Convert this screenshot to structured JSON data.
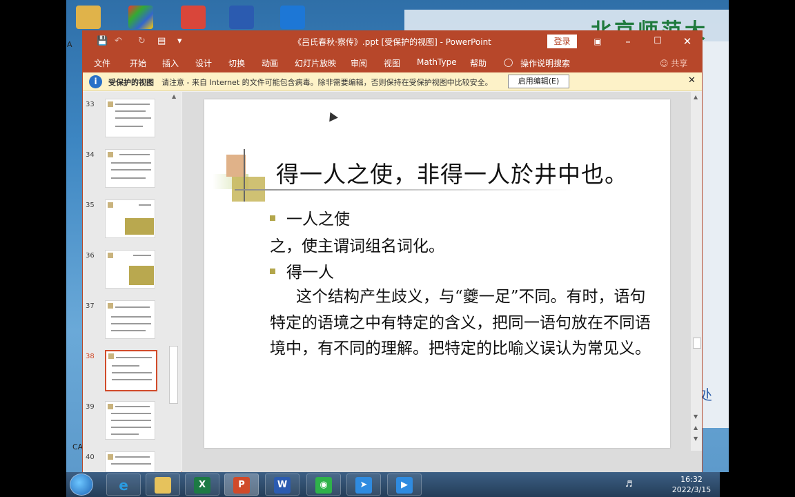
{
  "window": {
    "title": "《吕氏春秋·察传》.ppt [受保护的视图] - PowerPoint",
    "login_label": "登录"
  },
  "menu": {
    "items": [
      "文件",
      "开始",
      "插入",
      "设计",
      "切换",
      "动画",
      "幻灯片放映",
      "审阅",
      "视图",
      "MathType",
      "帮助"
    ],
    "search_label": "操作说明搜索",
    "share_label": "共享"
  },
  "infobar": {
    "title": "受保护的视图",
    "message": "请注意 - 来自 Internet 的文件可能包含病毒。除非需要编辑，否则保持在受保护视图中比较安全。",
    "enable_button": "启用编辑(E)"
  },
  "thumbnails": {
    "numbers": [
      "33",
      "34",
      "35",
      "36",
      "37",
      "38",
      "39",
      "40"
    ],
    "selected": "38"
  },
  "slide": {
    "title": "得一人之使，非得一人於井中也。",
    "bullet1": "一人之使",
    "line1": "之，使主谓词组名词化。",
    "bullet2": "得一人",
    "paragraph": "这个结构产生歧义，与“夔一足”不同。有时，语句特定的语境之中有特定的含义，把同一语句放在不同语境中，有不同的理解。把特定的比喻义误认为常见义。"
  },
  "taskbar": {
    "time": "16:32",
    "date": "2022/3/15"
  },
  "colors": {
    "accent": "#b7472a",
    "infobar": "#fdf2c8",
    "bullet": "#b3a64b"
  }
}
